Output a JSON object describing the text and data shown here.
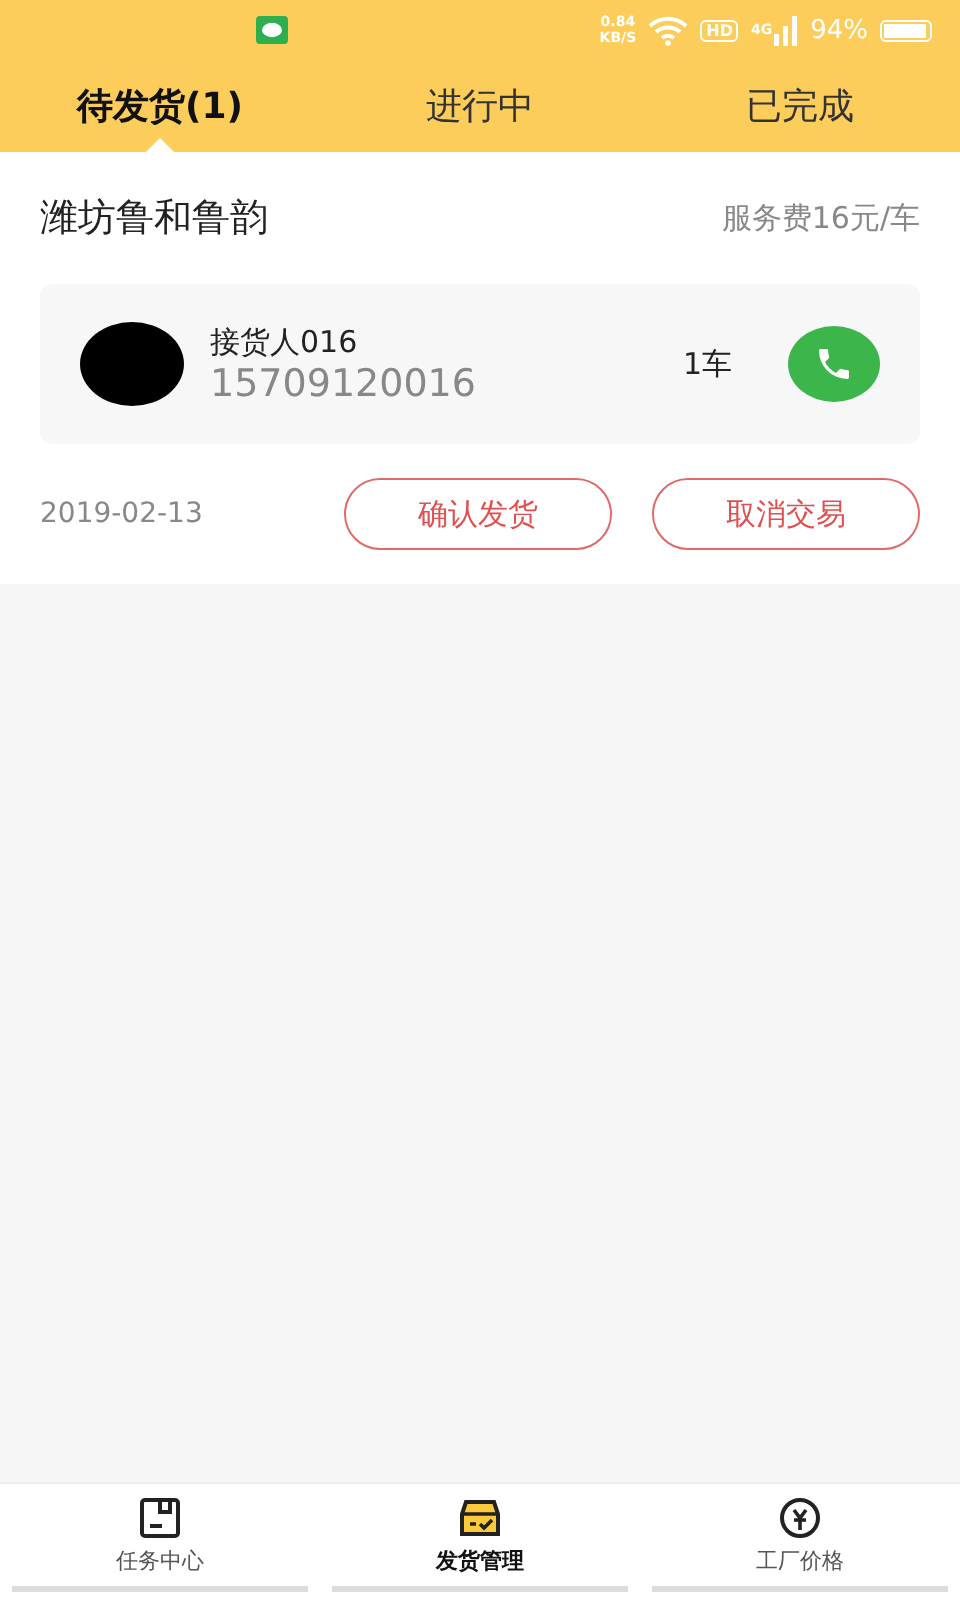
{
  "status_bar": {
    "speed": "0.84",
    "speed_unit": "KB/S",
    "hd": "HD",
    "network": "4G",
    "battery": "94%"
  },
  "tabs": [
    {
      "label": "待发货(1)",
      "selected": true
    },
    {
      "label": "进行中",
      "selected": false
    },
    {
      "label": "已完成",
      "selected": false
    }
  ],
  "orders": [
    {
      "title": "潍坊鲁和鲁韵",
      "fee": "服务费16元/车",
      "receiver": "接货人016",
      "phone": "15709120016",
      "quantity": "1车",
      "date": "2019-02-13",
      "actions": [
        "确认发货",
        "取消交易"
      ]
    }
  ],
  "bottom_nav": [
    {
      "label": "任务中心",
      "kind": "tasks",
      "selected": false
    },
    {
      "label": "发货管理",
      "kind": "shipping",
      "selected": true
    },
    {
      "label": "工厂价格",
      "kind": "prices",
      "selected": false
    }
  ]
}
